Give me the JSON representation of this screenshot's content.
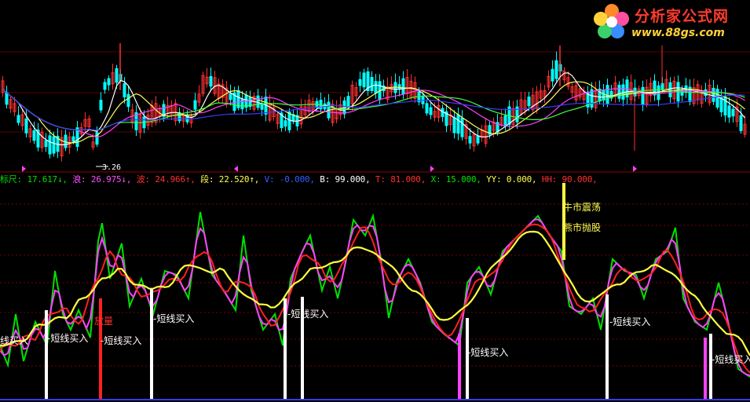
{
  "logo": {
    "title": "分析家公式网",
    "url": "www.88gs.com"
  },
  "main_panel": {
    "low_price_marker": "3.26"
  },
  "indicator": {
    "items": [
      {
        "label": "标尺",
        "value": "17.617",
        "arrow": "↓",
        "color": "#00e000"
      },
      {
        "label": "浪",
        "value": "26.975",
        "arrow": "↓",
        "color": "#ff50ff"
      },
      {
        "label": "波",
        "value": "24.966",
        "arrow": "↑",
        "color": "#ff3030"
      },
      {
        "label": "段",
        "value": "22.520",
        "arrow": "↑",
        "color": "#ffff50"
      },
      {
        "label": "V",
        "value": "-0.000",
        "arrow": "",
        "color": "#3060ff"
      },
      {
        "label": "B",
        "value": "99.000",
        "arrow": "",
        "color": "#ffffff"
      },
      {
        "label": "T",
        "value": "81.000",
        "arrow": "",
        "color": "#ff3030"
      },
      {
        "label": "X",
        "value": "15.000",
        "arrow": "",
        "color": "#00e000"
      },
      {
        "label": "YY",
        "value": "0.000",
        "arrow": "",
        "color": "#ffff50"
      },
      {
        "label": "HH",
        "value": "90.000",
        "arrow": "",
        "color": "#ff3030"
      }
    ]
  },
  "signals": [
    {
      "text": "线买入",
      "color": "#ffffff"
    },
    {
      "text": "短线买入",
      "color": "#ffffff"
    },
    {
      "text": "放量",
      "color": "#ff3030"
    },
    {
      "text": "短线买入",
      "color": "#ffffff"
    },
    {
      "text": "短线买入",
      "color": "#ffffff"
    },
    {
      "text": "短线买入",
      "color": "#ffffff"
    },
    {
      "text": "短线买入",
      "color": "#ffffff"
    },
    {
      "text": "牛市震荡",
      "color": "#ffff50"
    },
    {
      "text": "熊市抛股",
      "color": "#ffff50"
    },
    {
      "text": "短线买入",
      "color": "#ffffff"
    },
    {
      "text": "短线买入",
      "color": "#ffffff"
    }
  ],
  "colors": {
    "background": "#000000",
    "grid": "#8b0000",
    "up": "#ff3030",
    "down": "#00ffff",
    "green_line": "#00e000",
    "magenta_line": "#ff40ff",
    "red_line": "#ff2020",
    "yellow_line": "#ffff40"
  }
}
